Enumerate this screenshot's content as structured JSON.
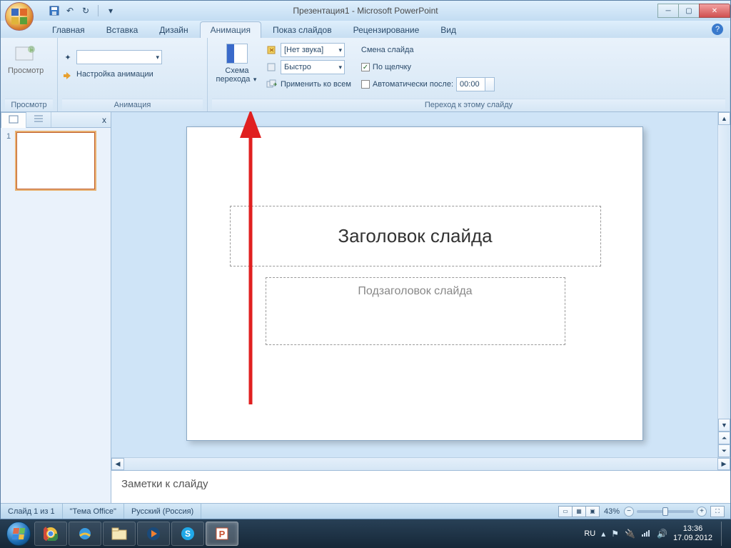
{
  "title": "Презентация1 - Microsoft PowerPoint",
  "tabs": {
    "home": "Главная",
    "insert": "Вставка",
    "design": "Дизайн",
    "animation": "Анимация",
    "slideshow": "Показ слайдов",
    "review": "Рецензирование",
    "view": "Вид"
  },
  "ribbon": {
    "preview_btn": "Просмотр",
    "group_preview": "Просмотр",
    "anim_settings": "Настройка анимации",
    "group_anim": "Анимация",
    "scheme_btn_l1": "Схема",
    "scheme_btn_l2": "перехода",
    "sound_value": "[Нет звука]",
    "speed_value": "Быстро",
    "apply_all": "Применить ко всем",
    "advance_title": "Смена слайда",
    "on_click": "По щелчку",
    "auto_after": "Автоматически после:",
    "auto_time": "00:00",
    "group_transition": "Переход к этому слайду"
  },
  "leftpane": {
    "close": "x",
    "thumb_num": "1"
  },
  "slide": {
    "title_ph": "Заголовок слайда",
    "subtitle_ph": "Подзаголовок слайда"
  },
  "notes_ph": "Заметки к слайду",
  "status": {
    "slide": "Слайд 1 из 1",
    "theme": "\"Тема Office\"",
    "lang": "Русский (Россия)",
    "zoom": "43%"
  },
  "tray": {
    "lang": "RU",
    "time": "13:36",
    "date": "17.09.2012"
  }
}
